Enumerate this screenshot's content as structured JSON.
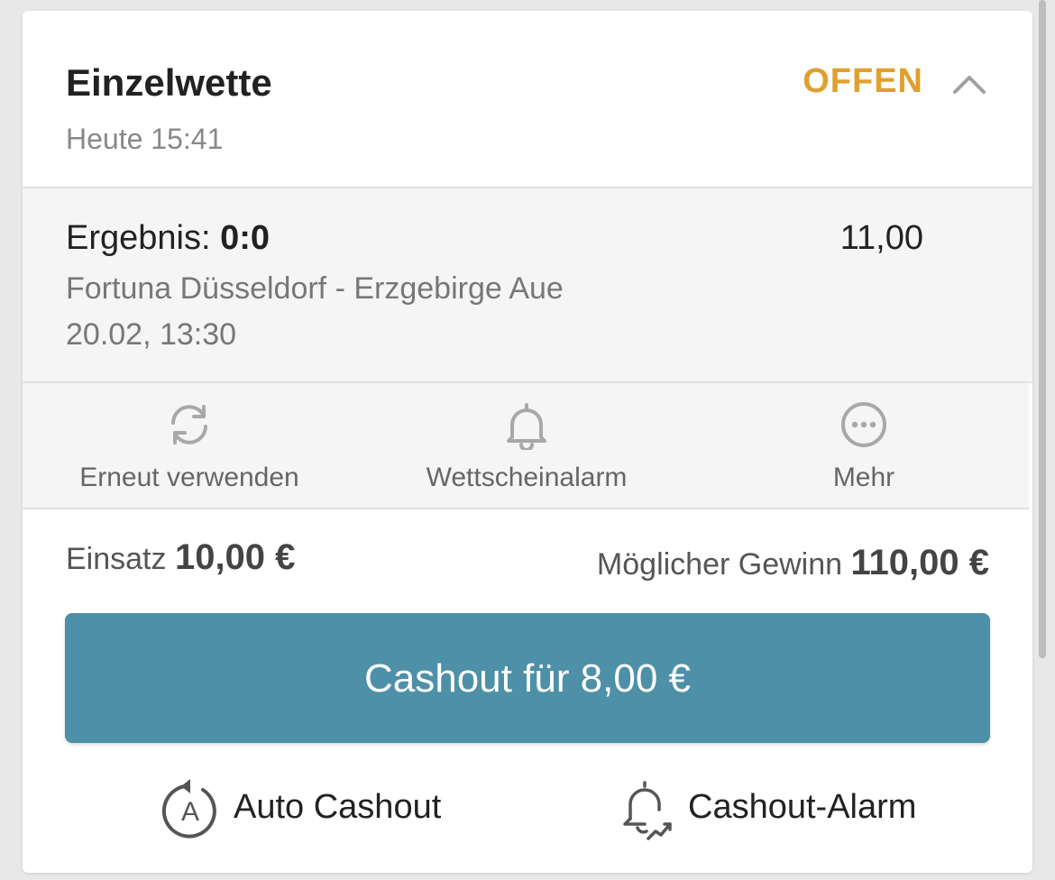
{
  "bet": {
    "type": "Einzelwette",
    "time": "Heute 15:41",
    "status": "OFFEN",
    "status_color": "#e0a030"
  },
  "selection": {
    "market_label": "Ergebnis:",
    "pick": "0:0",
    "odds": "11,00",
    "match": "Fortuna Düsseldorf - Erzgebirge Aue",
    "date": "20.02, 13:30"
  },
  "actions": [
    {
      "label": "Erneut verwenden",
      "icon": "refresh-icon"
    },
    {
      "label": "Wettscheinalarm",
      "icon": "bell-icon"
    },
    {
      "label": "Mehr",
      "icon": "more-icon"
    }
  ],
  "summary": {
    "stake_label": "Einsatz",
    "stake_value": "10,00 €",
    "win_label": "Möglicher Gewinn",
    "win_value": "110,00 €"
  },
  "cashout": {
    "button_label": "Cashout für 8,00 €",
    "button_color": "#4d90a8",
    "auto_label": "Auto Cashout",
    "alarm_label": "Cashout-Alarm"
  }
}
